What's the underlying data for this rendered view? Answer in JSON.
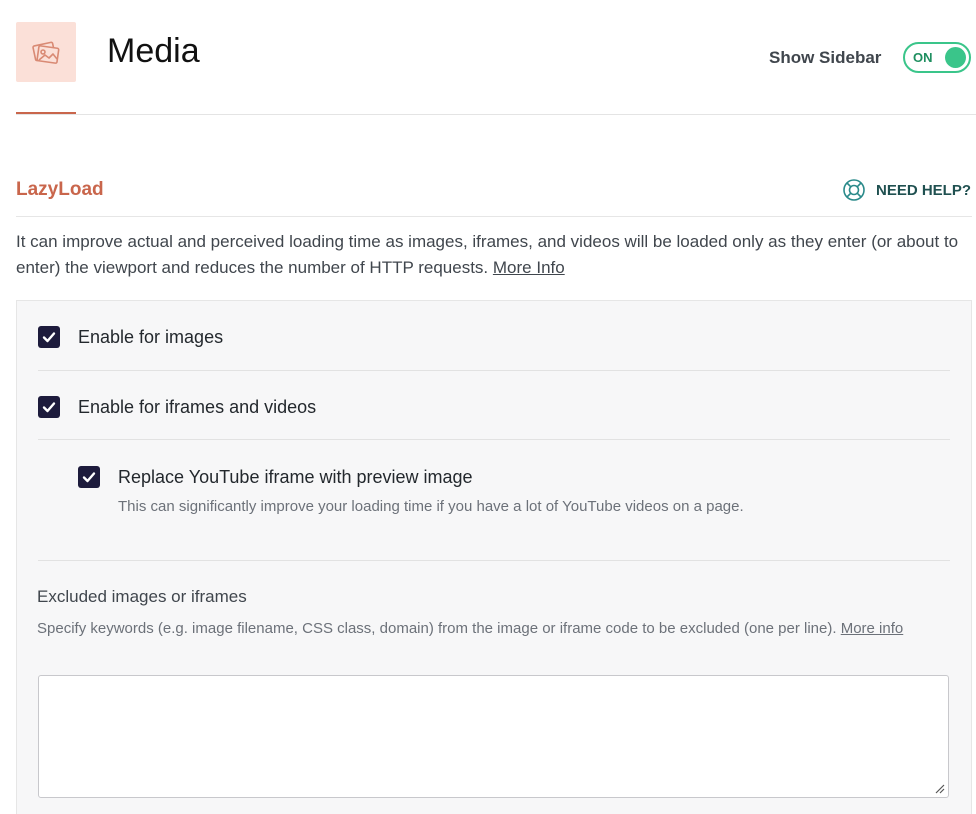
{
  "header": {
    "title": "Media",
    "sidebar_label": "Show Sidebar",
    "sidebar_toggle": "ON",
    "icon": "images-icon"
  },
  "section": {
    "title": "LazyLoad",
    "help_label": "NEED HELP?",
    "help_icon": "lifebuoy-icon",
    "description": "It can improve actual and perceived loading time as images, iframes, and videos will be loaded only as they enter (or about to enter) the viewport and reduces the number of HTTP requests.",
    "more_info": "More Info"
  },
  "options": {
    "images": {
      "label": "Enable for images",
      "checked": true
    },
    "iframes": {
      "label": "Enable for iframes and videos",
      "checked": true
    },
    "youtube": {
      "label": "Replace YouTube iframe with preview image",
      "checked": true,
      "description": "This can significantly improve your loading time if you have a lot of YouTube videos on a page."
    }
  },
  "excluded": {
    "title": "Excluded images or iframes",
    "description": "Specify keywords (e.g. image filename, CSS class, domain) from the image or iframe code to be excluded (one per line).",
    "more_info": "More info",
    "value": ""
  },
  "colors": {
    "accent": "#c9664c",
    "toggle_on": "#3ac58a",
    "checkbox": "#1d1b3c"
  }
}
